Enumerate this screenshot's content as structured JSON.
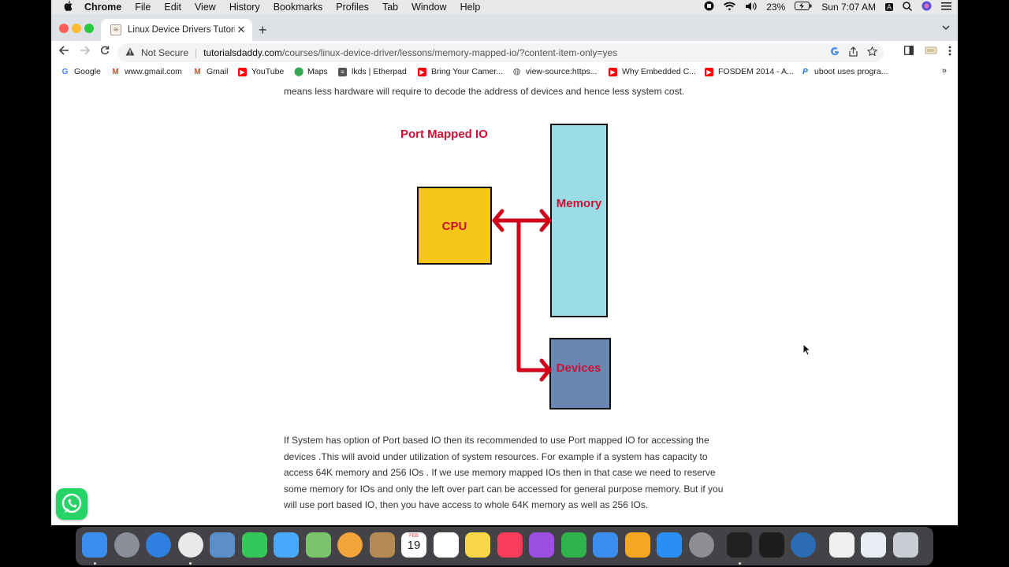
{
  "menubar": {
    "apple": "",
    "app_name": "Chrome",
    "menus": [
      "File",
      "Edit",
      "View",
      "History",
      "Bookmarks",
      "Profiles",
      "Tab",
      "Window",
      "Help"
    ],
    "battery": "23%",
    "clock": "Sun 7:07 AM",
    "input_indicator": "A"
  },
  "tab": {
    "title": "Linux Device Drivers Tutorials",
    "close": "✕",
    "new_tab": "+"
  },
  "toolbar": {
    "security_label": "Not Secure",
    "url_host": "tutorialsdaddy.com",
    "url_path": "/courses/linux-device-driver/lessons/memory-mapped-io/?content-item-only=yes"
  },
  "bookmarks": {
    "items": [
      {
        "label": "Google",
        "color": "#4285f4"
      },
      {
        "label": "www.gmail.com",
        "color": "#ea4335"
      },
      {
        "label": "Gmail",
        "color": "#ea4335"
      },
      {
        "label": "YouTube",
        "color": "#ff0000"
      },
      {
        "label": "Maps",
        "color": "#34a853"
      },
      {
        "label": "lkds | Etherpad",
        "color": "#666666"
      },
      {
        "label": "Bring Your Camer...",
        "color": "#ff0000"
      },
      {
        "label": "view-source:https...",
        "color": "#555555"
      },
      {
        "label": "Why Embedded C...",
        "color": "#ff0000"
      },
      {
        "label": "FOSDEM 2014 - A...",
        "color": "#ff0000"
      },
      {
        "label": "uboot uses progra...",
        "color": "#1a73e8"
      }
    ],
    "more": "»"
  },
  "content": {
    "para_top": "means less hardware will require to decode the address of devices and hence less system cost.",
    "diagram": {
      "title": "Port Mapped IO",
      "cpu_label": "CPU",
      "memory_label": "Memory",
      "devices_label": "Devices",
      "colors": {
        "title": "#cc1133",
        "cpu_fill": "#f5c518",
        "memory_fill": "#9adbe6",
        "devices_fill": "#6a86b3",
        "arrow": "#d0021b",
        "box_label": "#cc1133"
      }
    },
    "para_bottom": "If System has option of Port based IO then its recommended to use Port mapped IO for accessing the devices .This will avoid under utilization of system resources. For example if a system has capacity to access 64K memory and 256 IOs . If we use memory mapped IOs then in that case we need to reserve some memory for IOs and only the left over part can be accessed for general purpose memory. But if you will use port based IO, then you have access to whole 64K memory as well as 256 IOs."
  },
  "dock": {
    "apps": [
      {
        "name": "finder-icon",
        "color": "#3b8ef0"
      },
      {
        "name": "launchpad-icon",
        "color": "#8a8f99"
      },
      {
        "name": "safari-icon",
        "color": "#2f7fe0"
      },
      {
        "name": "chrome-icon",
        "color": "#e8e8e8"
      },
      {
        "name": "preview-icon",
        "color": "#5c8fc9"
      },
      {
        "name": "facetime-icon",
        "color": "#34c759"
      },
      {
        "name": "messages-icon",
        "color": "#4aa8ff"
      },
      {
        "name": "maps-icon",
        "color": "#7cc26a"
      },
      {
        "name": "photos-icon",
        "color": "#f2a33a"
      },
      {
        "name": "contacts-icon",
        "color": "#b58b55"
      },
      {
        "name": "calendar-icon",
        "color": "#ffffff"
      },
      {
        "name": "reminders-icon",
        "color": "#ffffff"
      },
      {
        "name": "notes-icon",
        "color": "#f7d64a"
      },
      {
        "name": "music-icon",
        "color": "#fa3c5a"
      },
      {
        "name": "podcasts-icon",
        "color": "#9b4ee0"
      },
      {
        "name": "numbers-icon",
        "color": "#2fb24c"
      },
      {
        "name": "keynote-icon",
        "color": "#3b8ef0"
      },
      {
        "name": "pages-icon",
        "color": "#f5a623"
      },
      {
        "name": "app-store-icon",
        "color": "#2b8ef5"
      },
      {
        "name": "system-preferences-icon",
        "color": "#8e8e93"
      },
      {
        "name": "terminal-icon",
        "color": "#222222"
      },
      {
        "name": "activity-monitor-icon",
        "color": "#1d1d1d"
      },
      {
        "name": "quicktime-icon",
        "color": "#2c6bb5"
      },
      {
        "name": "document-icon",
        "color": "#f0f0f0"
      },
      {
        "name": "screenshot-icon",
        "color": "#e9eef5"
      },
      {
        "name": "trash-icon",
        "color": "#c9ced4"
      }
    ],
    "calendar_month": "FEB",
    "calendar_day": "19"
  }
}
